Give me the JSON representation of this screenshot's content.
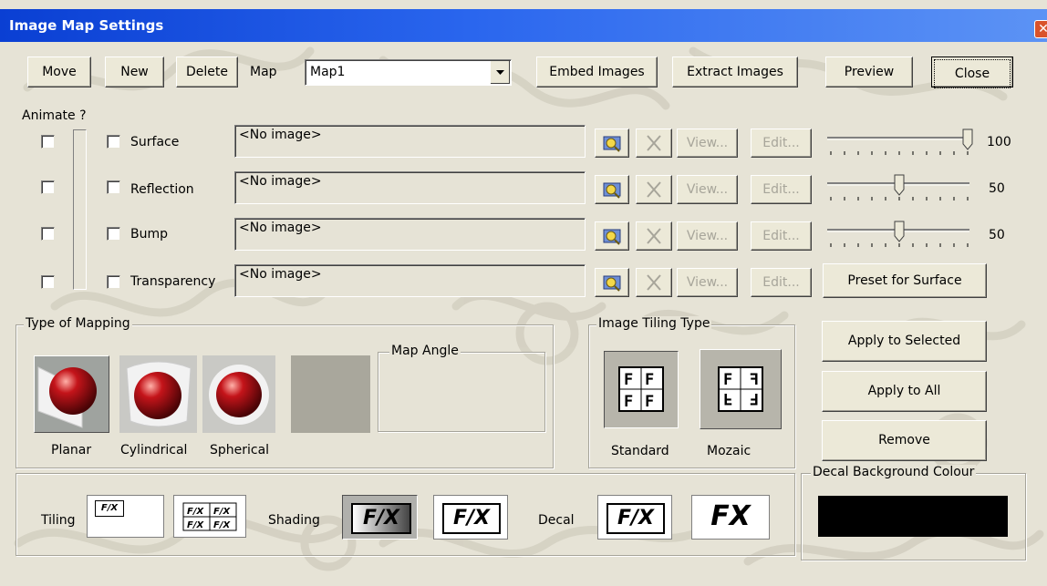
{
  "window": {
    "title": "Image Map Settings"
  },
  "toolbar": {
    "move": "Move",
    "new": "New",
    "delete": "Delete",
    "map_label": "Map",
    "map_value": "Map1",
    "embed": "Embed Images",
    "extract": "Extract  Images",
    "preview": "Preview",
    "close": "Close"
  },
  "animate_label": "Animate ?",
  "layers": [
    {
      "name": "Surface",
      "image": "<No image>",
      "value": "100",
      "level": 1.0
    },
    {
      "name": "Reflection",
      "image": "<No image>",
      "value": "50",
      "level": 0.5
    },
    {
      "name": "Bump",
      "image": "<No image>",
      "value": "50",
      "level": 0.5
    },
    {
      "name": "Transparency",
      "image": "<No image>"
    }
  ],
  "row_buttons": {
    "view": "View...",
    "edit": "Edit..."
  },
  "preset": "Preset for Surface",
  "mapping": {
    "title": "Type of Mapping",
    "planar": "Planar",
    "cylindrical": "Cylindrical",
    "spherical": "Spherical",
    "map_angle": "Map Angle"
  },
  "tiling_type": {
    "title": "Image Tiling Type",
    "standard": "Standard",
    "mozaic": "Mozaic"
  },
  "actions": {
    "apply_selected": "Apply to Selected",
    "apply_all": "Apply to All",
    "remove": "Remove"
  },
  "bottom": {
    "tiling": "Tiling",
    "shading": "Shading",
    "decal": "Decal",
    "fx_small": "F/X",
    "fx": "F/X",
    "fx_bold": "FX"
  },
  "decal_bg": {
    "title": "Decal Background Colour",
    "color": "#000000"
  },
  "colors": {
    "titlebar": "#0a3fd3",
    "face": "#ece9d8"
  }
}
